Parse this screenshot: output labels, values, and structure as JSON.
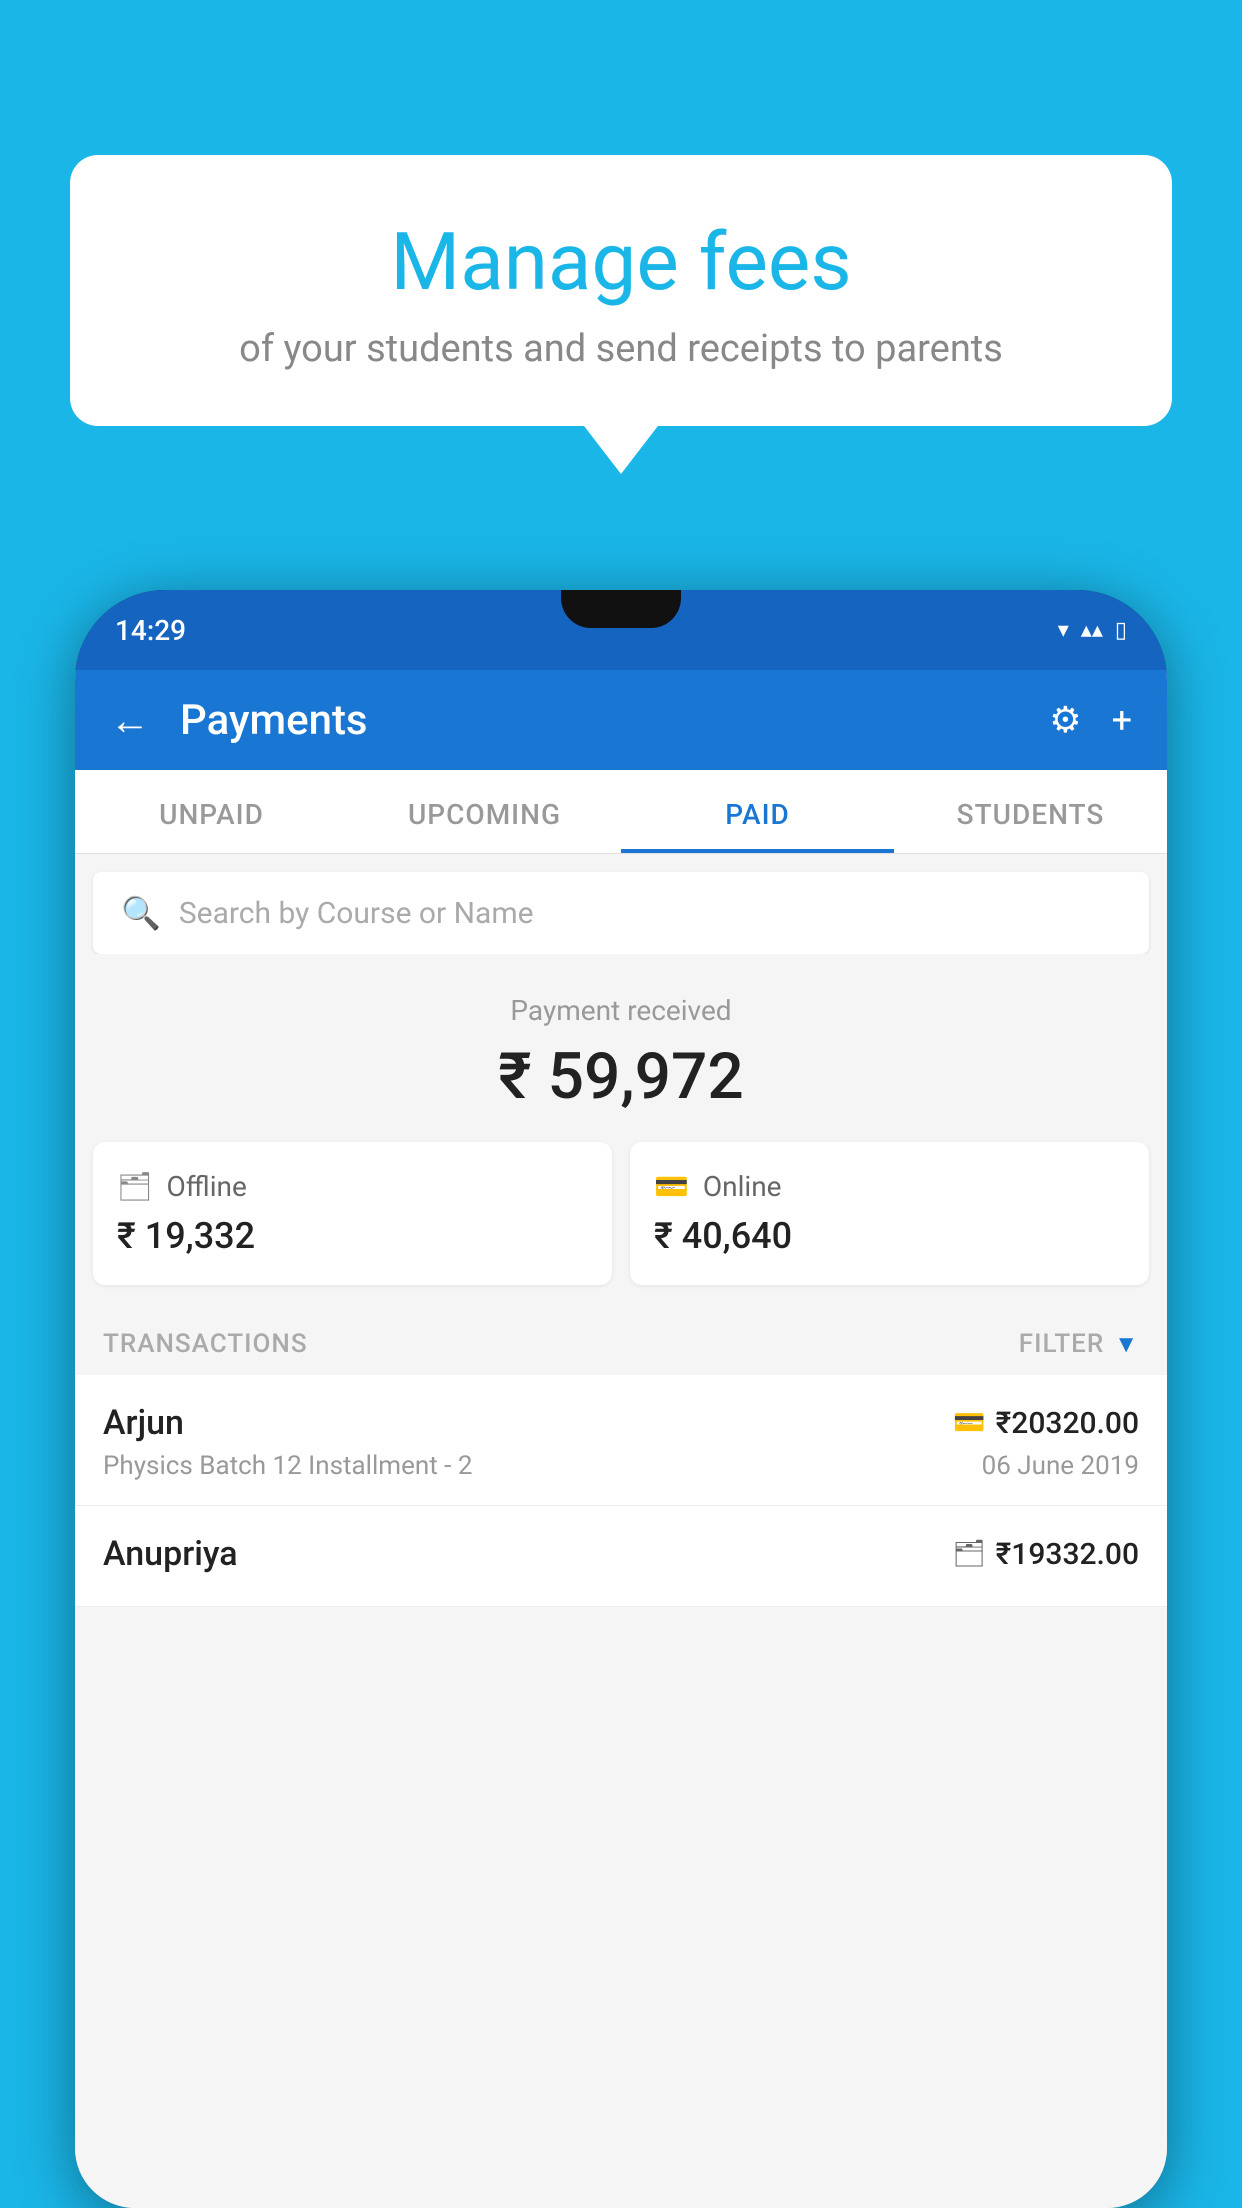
{
  "background_color": "#1ab6e8",
  "speech_bubble": {
    "title": "Manage fees",
    "subtitle": "of your students and send receipts to parents"
  },
  "status_bar": {
    "time": "14:29",
    "wifi_icon": "▾",
    "signal_icon": "▾",
    "battery_icon": "▯"
  },
  "header": {
    "title": "Payments",
    "back_label": "←",
    "settings_icon": "⚙",
    "add_icon": "+"
  },
  "tabs": [
    {
      "id": "unpaid",
      "label": "UNPAID",
      "active": false
    },
    {
      "id": "upcoming",
      "label": "UPCOMING",
      "active": false
    },
    {
      "id": "paid",
      "label": "PAID",
      "active": true
    },
    {
      "id": "students",
      "label": "STUDENTS",
      "active": false
    }
  ],
  "search": {
    "placeholder": "Search by Course or Name"
  },
  "payment_received": {
    "label": "Payment received",
    "amount": "₹ 59,972"
  },
  "payment_cards": [
    {
      "type": "Offline",
      "amount": "₹ 19,332",
      "icon": "💳"
    },
    {
      "type": "Online",
      "amount": "₹ 40,640",
      "icon": "💳"
    }
  ],
  "transactions_section": {
    "label": "TRANSACTIONS",
    "filter_label": "FILTER"
  },
  "transactions": [
    {
      "name": "Arjun",
      "course": "Physics Batch 12 Installment - 2",
      "amount": "₹20320.00",
      "date": "06 June 2019",
      "payment_type": "online"
    },
    {
      "name": "Anupriya",
      "course": "",
      "amount": "₹19332.00",
      "date": "",
      "payment_type": "offline"
    }
  ]
}
